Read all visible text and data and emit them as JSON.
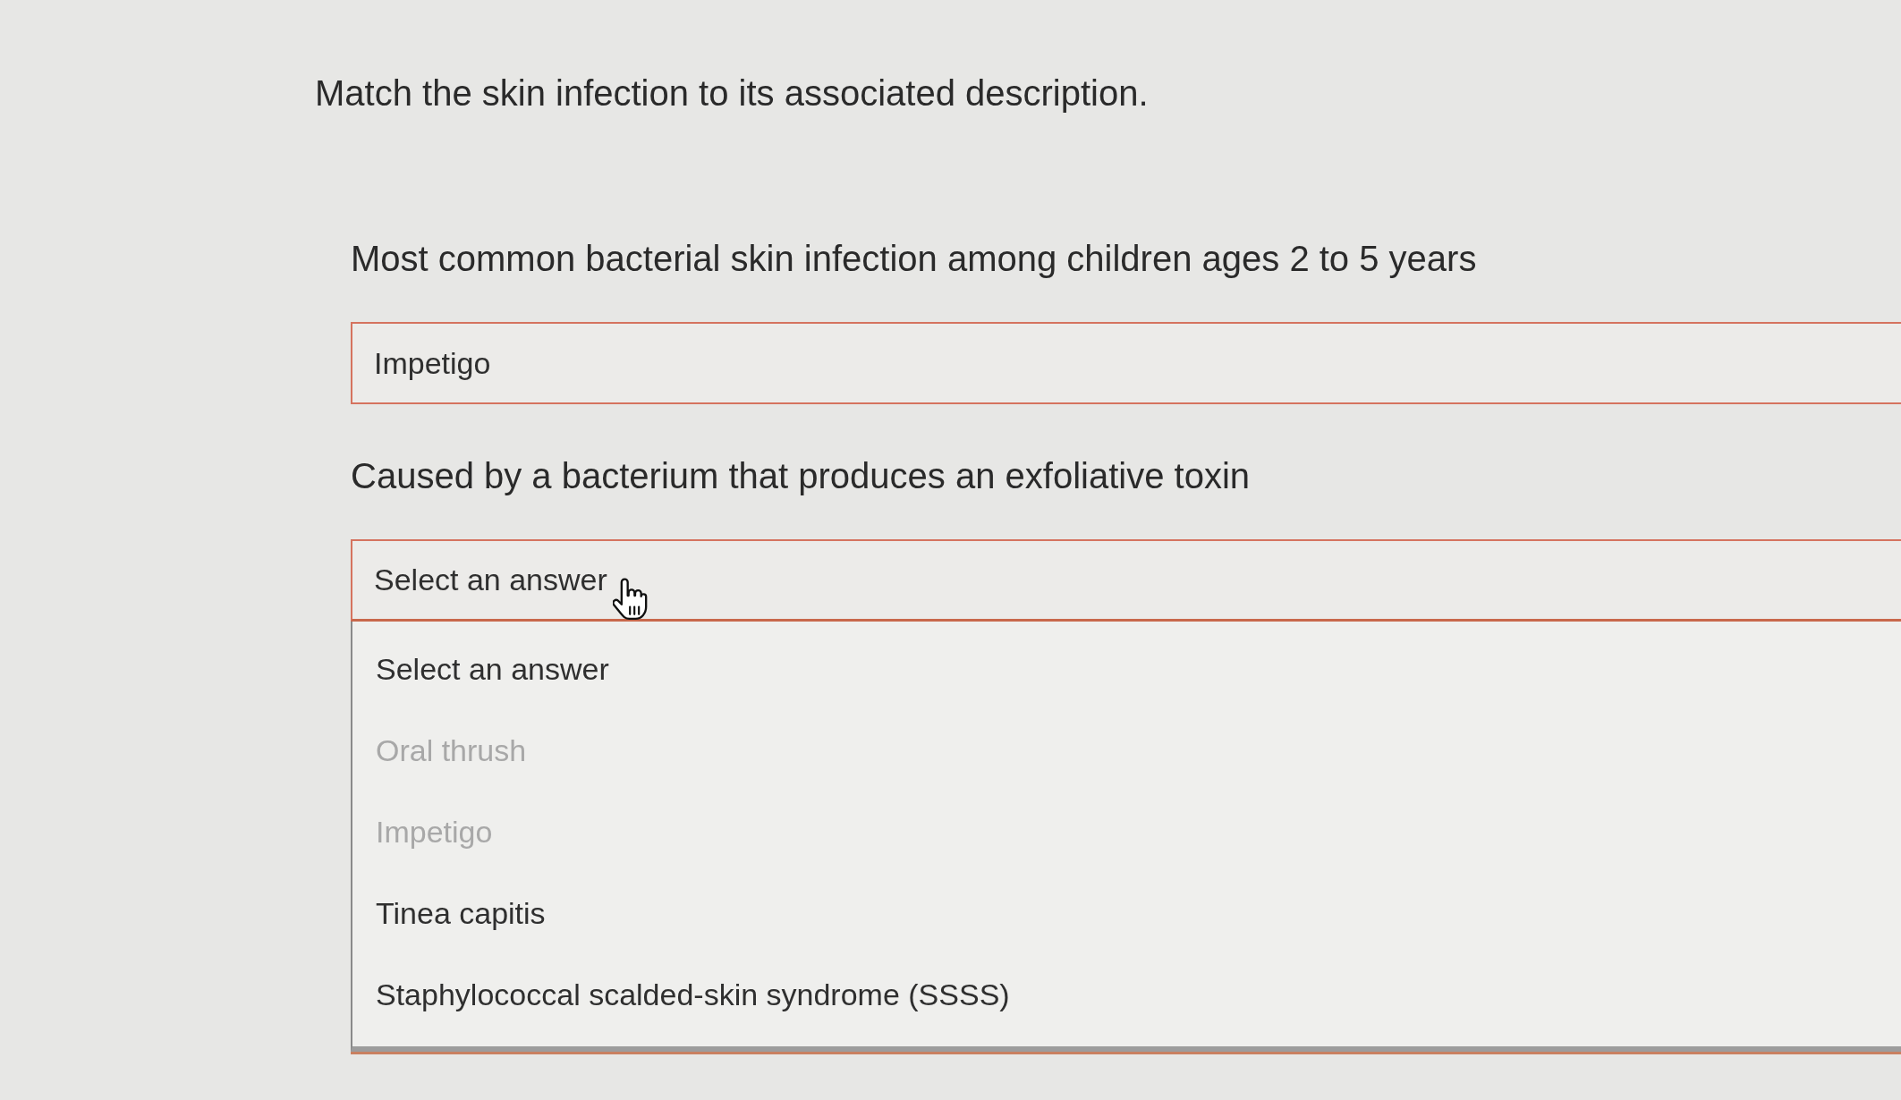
{
  "instructions": "Match the skin infection to its associated description.",
  "questions": [
    {
      "prompt": "Most common bacterial skin infection among children ages 2 to 5 years",
      "answer": {
        "value": "Impetigo",
        "expanded": false
      }
    },
    {
      "prompt": "Caused by a bacterium that produces an exfoliative toxin",
      "answer": {
        "value": "Select an answer",
        "expanded": true,
        "options": [
          {
            "label": "Select an answer",
            "disabled": false
          },
          {
            "label": "Oral thrush",
            "disabled": true
          },
          {
            "label": "Impetigo",
            "disabled": true
          },
          {
            "label": "Tinea capitis",
            "disabled": false
          },
          {
            "label": "Staphylococcal scalded-skin syndrome (SSSS)",
            "disabled": false
          }
        ]
      }
    }
  ]
}
